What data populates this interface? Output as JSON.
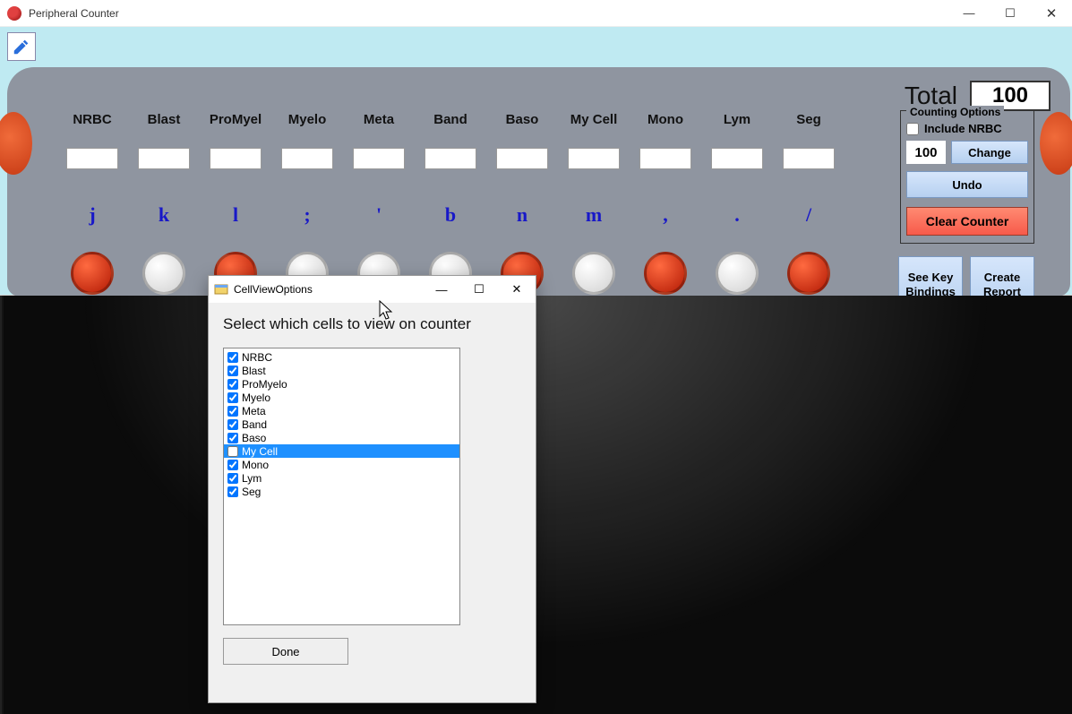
{
  "mainWindow": {
    "title": "Peripheral Counter"
  },
  "total": {
    "label": "Total",
    "value": "100"
  },
  "cells": [
    {
      "name": "NRBC",
      "key": "j",
      "color": "red"
    },
    {
      "name": "Blast",
      "key": "k",
      "color": "white"
    },
    {
      "name": "ProMyel",
      "key": "l",
      "color": "red"
    },
    {
      "name": "Myelo",
      "key": ";",
      "color": "white"
    },
    {
      "name": "Meta",
      "key": "'",
      "color": "white"
    },
    {
      "name": "Band",
      "key": "b",
      "color": "white"
    },
    {
      "name": "Baso",
      "key": "n",
      "color": "red"
    },
    {
      "name": "My Cell",
      "key": "m",
      "color": "white"
    },
    {
      "name": "Mono",
      "key": ",",
      "color": "red"
    },
    {
      "name": "Lym",
      "key": ".",
      "color": "white"
    },
    {
      "name": "Seg",
      "key": "/",
      "color": "red"
    }
  ],
  "options": {
    "legend": "Counting Options",
    "includeNrbc": "Include NRBC",
    "threshold": "100",
    "change": "Change",
    "undo": "Undo",
    "clear": "Clear Counter",
    "seeKey": "See Key Bindings",
    "createReport": "Create Report"
  },
  "dialog": {
    "title": "CellViewOptions",
    "prompt": "Select which cells to view on counter",
    "items": [
      {
        "label": "NRBC",
        "checked": true,
        "selected": false
      },
      {
        "label": "Blast",
        "checked": true,
        "selected": false
      },
      {
        "label": "ProMyelo",
        "checked": true,
        "selected": false
      },
      {
        "label": "Myelo",
        "checked": true,
        "selected": false
      },
      {
        "label": "Meta",
        "checked": true,
        "selected": false
      },
      {
        "label": "Band",
        "checked": true,
        "selected": false
      },
      {
        "label": "Baso",
        "checked": true,
        "selected": false
      },
      {
        "label": "My Cell",
        "checked": false,
        "selected": true
      },
      {
        "label": "Mono",
        "checked": true,
        "selected": false
      },
      {
        "label": "Lym",
        "checked": true,
        "selected": false
      },
      {
        "label": "Seg",
        "checked": true,
        "selected": false
      }
    ],
    "done": "Done"
  }
}
